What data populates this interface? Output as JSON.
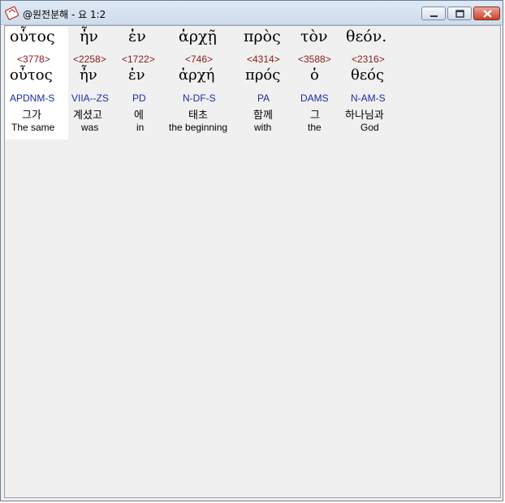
{
  "window": {
    "title": "@원전분해 - 요 1:2"
  },
  "colors": {
    "strong": "#8b1a1a",
    "morph": "#1a2ca0",
    "highlight": "#ffffff"
  },
  "words": [
    {
      "greek": "οὗτος",
      "strong": "<3778>",
      "lemma": "οὗτος",
      "morph": "APDNM-S",
      "korean": "그가",
      "english": "The same"
    },
    {
      "greek": "ἦν",
      "strong": "<2258>",
      "lemma": "ἦν",
      "morph": "VIIA--ZS",
      "korean": "계셨고",
      "english": "was"
    },
    {
      "greek": "ἐν",
      "strong": "<1722>",
      "lemma": "ἐν",
      "morph": "PD",
      "korean": "에",
      "english": "in"
    },
    {
      "greek": "ἀρχῇ",
      "strong": "<746>",
      "lemma": "ἀρχή",
      "morph": "N-DF-S",
      "korean": "태초",
      "english": "the beginning"
    },
    {
      "greek": "πρὸς",
      "strong": "<4314>",
      "lemma": "πρός",
      "morph": "PA",
      "korean": "함께",
      "english": "with"
    },
    {
      "greek": "τὸν",
      "strong": "<3588>",
      "lemma": "ὁ",
      "morph": "DAMS",
      "korean": "그",
      "english": "the"
    },
    {
      "greek": "θεόν.",
      "strong": "<2316>",
      "lemma": "θεός",
      "morph": "N-AM-S",
      "korean": "하나님과",
      "english": "God"
    }
  ]
}
